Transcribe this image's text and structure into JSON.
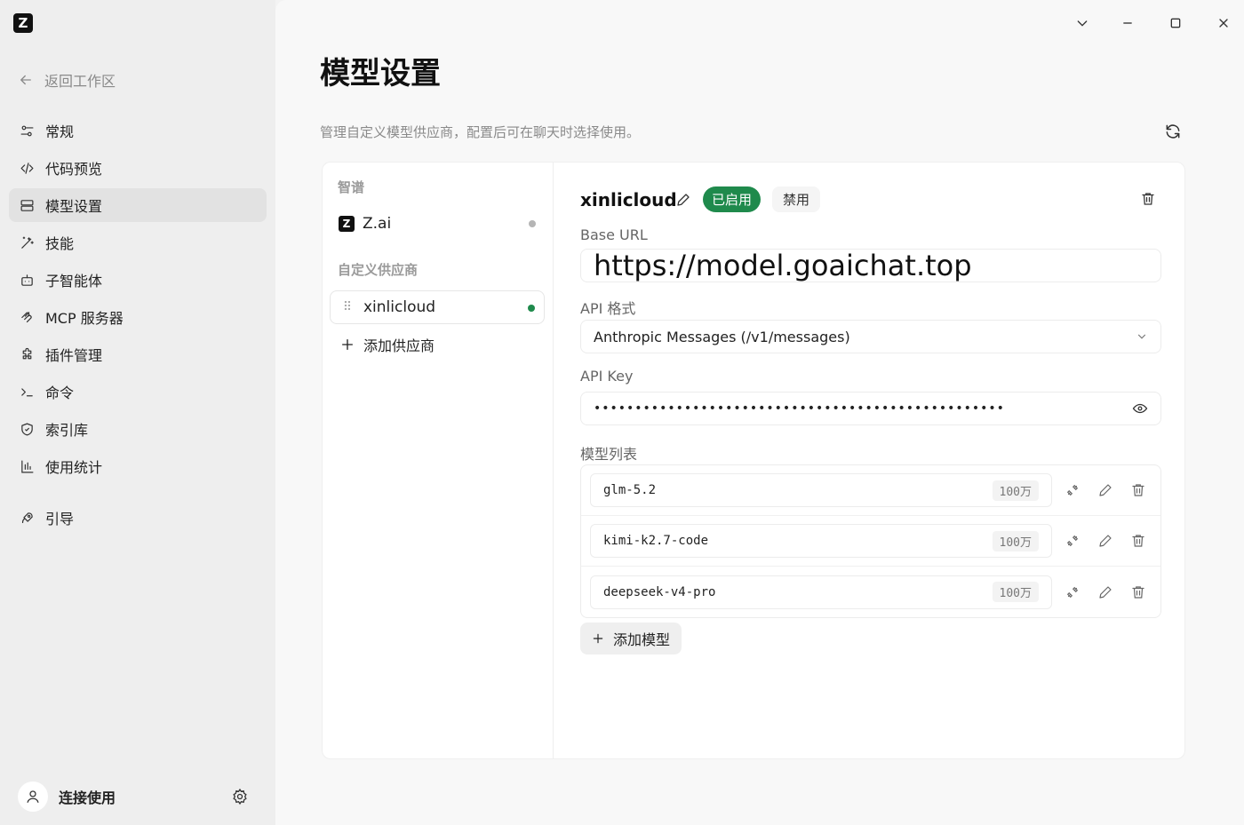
{
  "app": {
    "logo_letter": "Z"
  },
  "sidebar": {
    "back_label": "返回工作区",
    "items": [
      {
        "label": "常规",
        "icon": "sliders-icon"
      },
      {
        "label": "代码预览",
        "icon": "code-icon"
      },
      {
        "label": "模型设置",
        "icon": "server-icon",
        "active": true
      },
      {
        "label": "技能",
        "icon": "magic-wand-icon"
      },
      {
        "label": "子智能体",
        "icon": "bot-icon"
      },
      {
        "label": "MCP 服务器",
        "icon": "mcp-icon"
      },
      {
        "label": "插件管理",
        "icon": "puzzle-icon"
      },
      {
        "label": "命令",
        "icon": "terminal-icon"
      },
      {
        "label": "索引库",
        "icon": "shield-icon"
      },
      {
        "label": "使用统计",
        "icon": "bar-chart-icon"
      }
    ],
    "guide_label": "引导",
    "user_name": "连接使用"
  },
  "page": {
    "title": "模型设置",
    "description": "管理自定义模型供应商，配置后可在聊天时选择使用。"
  },
  "providers": {
    "builtin_section": "智谱",
    "builtin": [
      {
        "name": "Z.ai",
        "status": "inactive",
        "status_color": "#b5b5b5"
      }
    ],
    "custom_section": "自定义供应商",
    "custom": [
      {
        "name": "xinlicloud",
        "status": "active",
        "status_color": "#1f8a4c"
      }
    ],
    "add_label": "添加供应商"
  },
  "detail": {
    "name": "xinlicloud",
    "enabled_badge": "已启用",
    "disable_label": "禁用",
    "base_url_label": "Base URL",
    "base_url": "https://model.goaichat.top",
    "api_format_label": "API 格式",
    "api_format": "Anthropic Messages (/v1/messages)",
    "api_key_label": "API Key",
    "api_key_masked": "••••••••••••••••••••••••••••••••••••••••••••••••••",
    "models_label": "模型列表",
    "models": [
      {
        "name": "glm-5.2",
        "context": "100万"
      },
      {
        "name": "kimi-k2.7-code",
        "context": "100万"
      },
      {
        "name": "deepseek-v4-pro",
        "context": "100万"
      }
    ],
    "add_model_label": "添加模型"
  },
  "colors": {
    "accent_green": "#1f8a4c"
  }
}
